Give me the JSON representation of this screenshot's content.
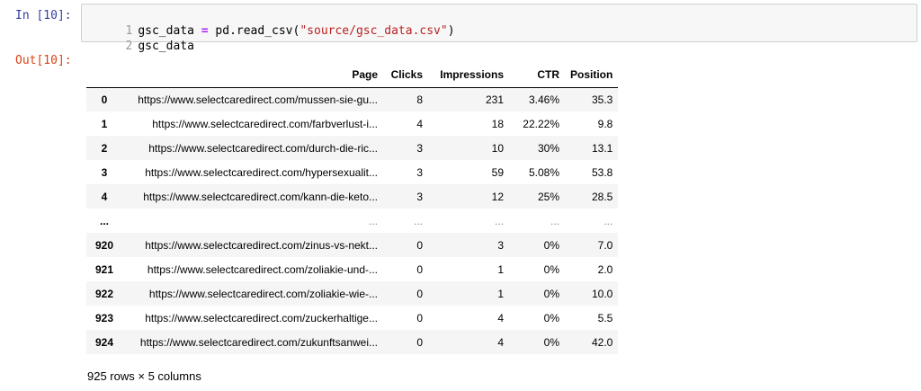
{
  "input_prompt": "In [10]:",
  "output_prompt": "Out[10]:",
  "code": {
    "lines": [
      {
        "num": "1",
        "var": "gsc_data",
        "op": "=",
        "call_prefix": " pd.read_csv(",
        "str": "\"source/gsc_data.csv\"",
        "call_suffix": ")"
      },
      {
        "num": "2",
        "text": "gsc_data"
      }
    ]
  },
  "table": {
    "columns": [
      "",
      "Page",
      "Clicks",
      "Impressions",
      "CTR",
      "Position"
    ],
    "rows": [
      [
        "0",
        "https://www.selectcaredirect.com/mussen-sie-gu...",
        "8",
        "231",
        "3.46%",
        "35.3"
      ],
      [
        "1",
        "https://www.selectcaredirect.com/farbverlust-i...",
        "4",
        "18",
        "22.22%",
        "9.8"
      ],
      [
        "2",
        "https://www.selectcaredirect.com/durch-die-ric...",
        "3",
        "10",
        "30%",
        "13.1"
      ],
      [
        "3",
        "https://www.selectcaredirect.com/hypersexualit...",
        "3",
        "59",
        "5.08%",
        "53.8"
      ],
      [
        "4",
        "https://www.selectcaredirect.com/kann-die-keto...",
        "3",
        "12",
        "25%",
        "28.5"
      ],
      [
        "...",
        "...",
        "...",
        "...",
        "...",
        "..."
      ],
      [
        "920",
        "https://www.selectcaredirect.com/zinus-vs-nekt...",
        "0",
        "3",
        "0%",
        "7.0"
      ],
      [
        "921",
        "https://www.selectcaredirect.com/zoliakie-und-...",
        "0",
        "1",
        "0%",
        "2.0"
      ],
      [
        "922",
        "https://www.selectcaredirect.com/zoliakie-wie-...",
        "0",
        "1",
        "0%",
        "10.0"
      ],
      [
        "923",
        "https://www.selectcaredirect.com/zuckerhaltige...",
        "0",
        "4",
        "0%",
        "5.5"
      ],
      [
        "924",
        "https://www.selectcaredirect.com/zukunftsanwei...",
        "0",
        "4",
        "0%",
        "42.0"
      ]
    ]
  },
  "shape_text": "925 rows × 5 columns",
  "colors": {
    "input_prompt": "#303f9f",
    "output_prompt": "#d84315",
    "string": "#ba2121",
    "operator": "#aa22ff",
    "line_number": "#999999",
    "code_bg": "#f7f7f7",
    "stripe": "#f5f5f5"
  }
}
